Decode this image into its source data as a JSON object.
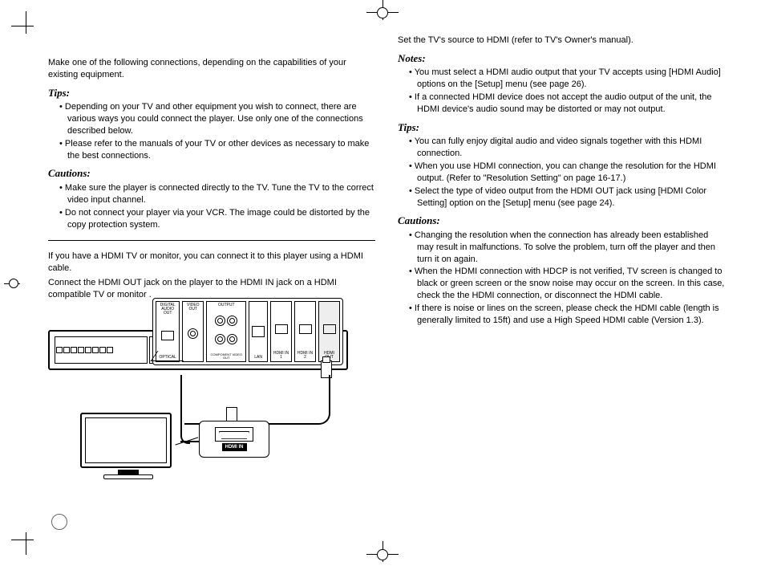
{
  "left": {
    "intro": "Make one of the following connections, depending on the capabilities of your existing equipment.",
    "tips_h": "Tips:",
    "tips": [
      "Depending on your TV and other equipment you wish to connect, there are various ways you could connect the player. Use only one of the connections described below.",
      "Please refer to the manuals of your TV or other devices as necessary to make the best connections."
    ],
    "cautions_h": "Cautions:",
    "cautions": [
      "Make sure the player is connected directly to the TV. Tune the TV to the correct video input channel.",
      "Do not connect your player via your VCR. The image could be distorted by the copy protection system."
    ],
    "hdmi_p1": "If you have a HDMI TV or monitor, you can connect it to this player using a HDMI cable.",
    "hdmi_p2": "Connect the HDMI OUT jack on the player to the HDMI IN jack on a HDMI compatible TV or monitor      .",
    "diagram": {
      "optical": "OPTICAL",
      "video_out": "VIDEO OUT",
      "output": "OUTPUT",
      "component_out": "COMPONENT VIDEO OUT",
      "lan": "LAN",
      "hdmi_in1": "HDMI IN 1",
      "hdmi_in2": "HDMI IN 2",
      "hdmi_out": "HDMI OUT",
      "hdmi_in_tv": "HDMI IN"
    }
  },
  "right": {
    "set_source": "Set the TV's source to HDMI (refer to TV's Owner's manual).",
    "notes_h": "Notes:",
    "notes": [
      "You must select a HDMI audio output that your TV accepts using [HDMI Audio] options on the [Setup] menu (see page 26).",
      "If a connected HDMI device does not accept the audio output of the unit, the HDMI device's audio sound may be distorted or may not output."
    ],
    "tips_h": "Tips:",
    "tips": [
      "You can fully enjoy digital audio and video signals together with this HDMI connection.",
      "When you use HDMI connection, you can change the resolution for the HDMI output. (Refer to \"Resolution Setting\" on page 16-17.)",
      "Select the type of video output from the HDMI OUT jack using [HDMI Color Setting] option on the [Setup] menu (see page 24)."
    ],
    "cautions_h": "Cautions:",
    "cautions": [
      "Changing the resolution when the connection has already been established may result in malfunctions. To solve the problem, turn off the player and then turn it on again.",
      "When the HDMI connection with HDCP is not verified, TV screen is changed to black or green screen or the snow noise may occur on the screen. In this case, check the the HDMI connection, or disconnect the HDMI cable.",
      "If there is noise or lines on the screen, please check the HDMI cable (length is generally limited to 15ft) and use a High Speed HDMI cable (Version 1.3)."
    ]
  }
}
